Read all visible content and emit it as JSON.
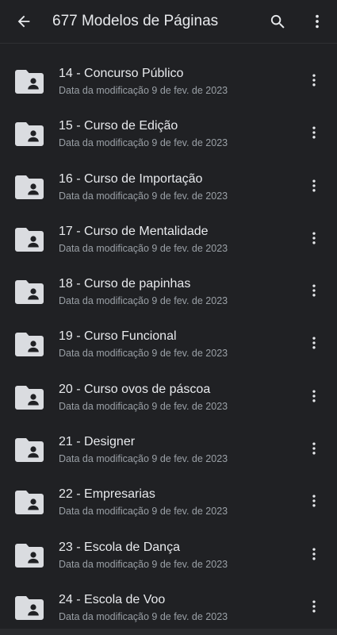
{
  "header": {
    "title": "677 Modelos de Páginas",
    "back_icon": "arrow-back-icon",
    "search_icon": "search-icon",
    "menu_icon": "more-vert-icon"
  },
  "colors": {
    "background": "#202124",
    "primary_text": "#e8eaed",
    "secondary_text": "#9aa0a6",
    "folder": "#dadce0"
  },
  "items": [
    {
      "title": "14 - Concurso Público",
      "meta": "Data da modificação 9 de fev. de 2023",
      "icon": "shared-folder-icon"
    },
    {
      "title": "15 - Curso de Edição",
      "meta": "Data da modificação 9 de fev. de 2023",
      "icon": "shared-folder-icon"
    },
    {
      "title": "16 - Curso de Importação",
      "meta": "Data da modificação 9 de fev. de 2023",
      "icon": "shared-folder-icon"
    },
    {
      "title": "17 - Curso de Mentalidade",
      "meta": "Data da modificação 9 de fev. de 2023",
      "icon": "shared-folder-icon"
    },
    {
      "title": "18 - Curso de papinhas",
      "meta": "Data da modificação 9 de fev. de 2023",
      "icon": "shared-folder-icon"
    },
    {
      "title": "19 - Curso Funcional",
      "meta": "Data da modificação 9 de fev. de 2023",
      "icon": "shared-folder-icon"
    },
    {
      "title": "20 - Curso ovos de páscoa",
      "meta": "Data da modificação 9 de fev. de 2023",
      "icon": "shared-folder-icon"
    },
    {
      "title": "21 - Designer",
      "meta": "Data da modificação 9 de fev. de 2023",
      "icon": "shared-folder-icon"
    },
    {
      "title": "22 - Empresarias",
      "meta": "Data da modificação 9 de fev. de 2023",
      "icon": "shared-folder-icon"
    },
    {
      "title": "23 - Escola de Dança",
      "meta": "Data da modificação 9 de fev. de 2023",
      "icon": "shared-folder-icon"
    },
    {
      "title": "24 - Escola de Voo",
      "meta": "Data da modificação 9 de fev. de 2023",
      "icon": "shared-folder-icon"
    }
  ]
}
